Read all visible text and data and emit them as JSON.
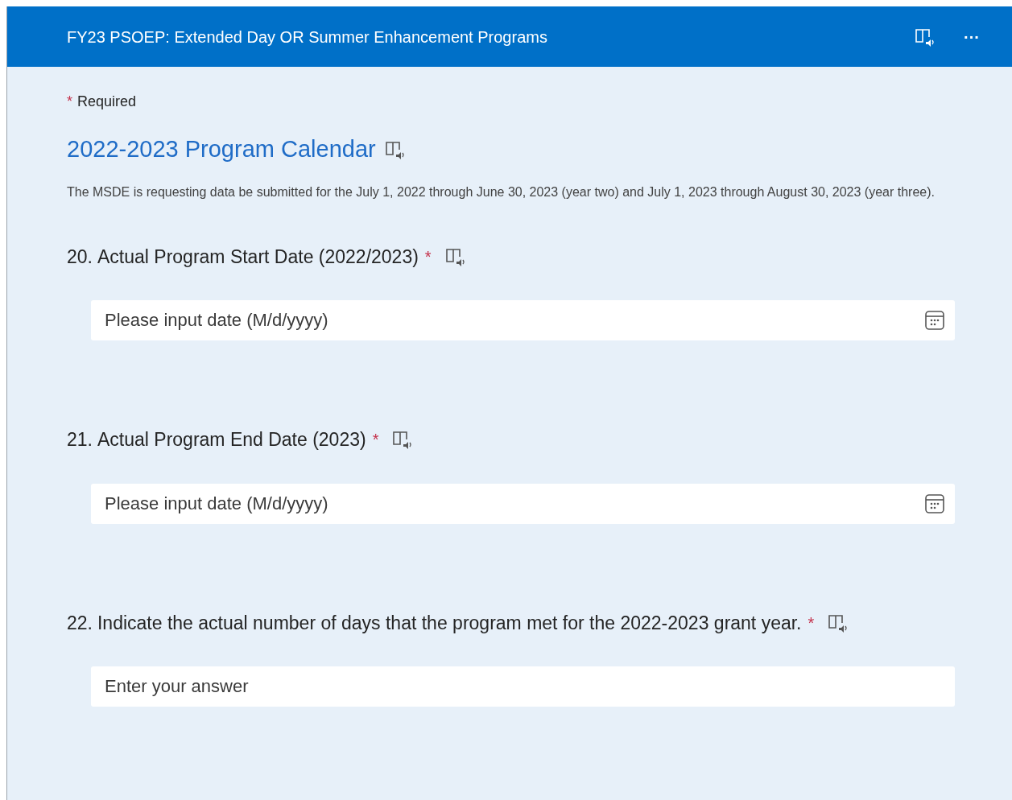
{
  "header": {
    "title": "FY23 PSOEP: Extended Day OR Summer Enhancement Programs",
    "menu": "···"
  },
  "required_note": {
    "mark": "*",
    "label": "Required"
  },
  "section": {
    "title": "2022-2023 Program Calendar",
    "description": "The MSDE is requesting data be submitted for the July 1, 2022 through June 30, 2023 (year two) and July 1, 2023 through August 30, 2023 (year three)."
  },
  "questions": [
    {
      "number": "20.",
      "text": "Actual Program Start Date (2022/2023)",
      "required": true,
      "kind": "date",
      "placeholder": "Please input date (M/d/yyyy)"
    },
    {
      "number": "21.",
      "text": "Actual Program End Date (2023)",
      "required": true,
      "kind": "date",
      "placeholder": "Please input date (M/d/yyyy)"
    },
    {
      "number": "22.",
      "text": "Indicate the actual number of days that the program met for the 2022-2023 grant year.",
      "required": true,
      "kind": "text",
      "placeholder": "Enter your answer"
    }
  ]
}
